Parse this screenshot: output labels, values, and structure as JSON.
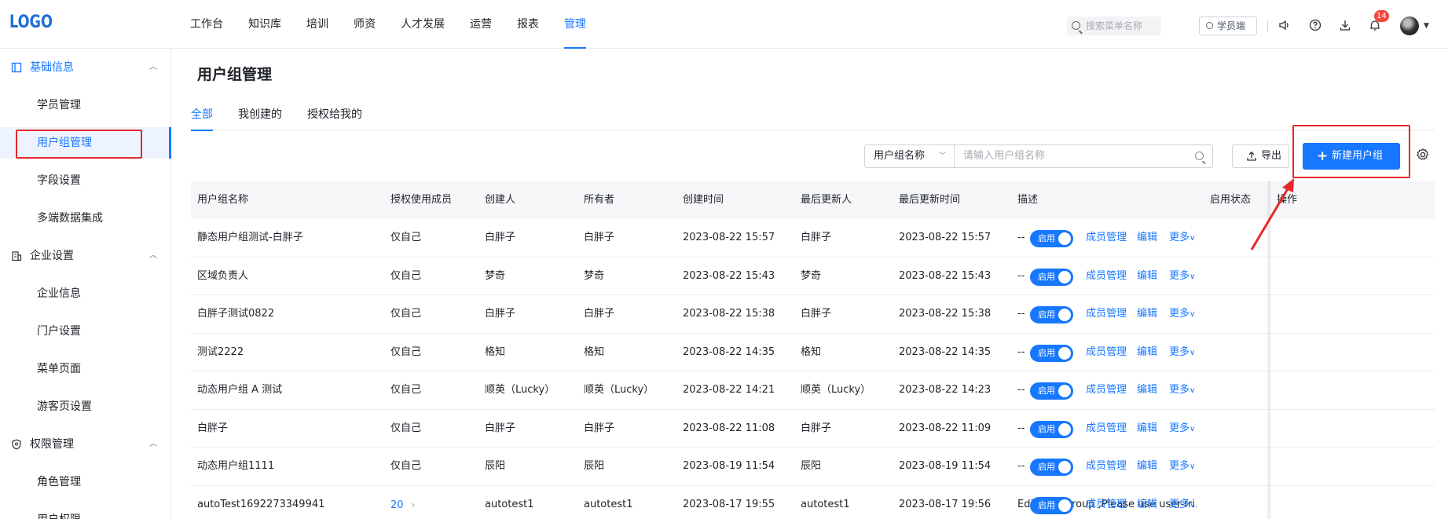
{
  "logo": "LOGO",
  "nav": [
    "工作台",
    "知识库",
    "培训",
    "师资",
    "人才发展",
    "运营",
    "报表",
    "管理"
  ],
  "nav_active": "管理",
  "top_search_placeholder": "搜索菜单名称",
  "student_button": "学员端",
  "notification_count": "14",
  "sidebar": {
    "group1": "基础信息",
    "group1_items": [
      "学员管理",
      "用户组管理",
      "字段设置",
      "多端数据集成"
    ],
    "group2": "企业设置",
    "group2_items": [
      "企业信息",
      "门户设置",
      "菜单页面",
      "游客页设置"
    ],
    "group3": "权限管理",
    "group3_items": [
      "角色管理",
      "用户权限"
    ]
  },
  "page_title": "用户组管理",
  "tabs": [
    "全部",
    "我创建的",
    "授权给我的"
  ],
  "filter": {
    "select_value": "用户组名称",
    "placeholder": "请输入用户组名称"
  },
  "export_label": "导出",
  "new_label": "新建用户组",
  "columns": [
    "用户组名称",
    "授权使用成员",
    "创建人",
    "所有者",
    "创建时间",
    "最后更新人",
    "最后更新时间",
    "描述",
    "启用状态",
    "操作"
  ],
  "rows": [
    {
      "name": "静态用户组测试-白胖子",
      "auth": "仅自己",
      "creator": "白胖子",
      "owner": "白胖子",
      "created": "2023-08-22 15:57",
      "updater": "白胖子",
      "updated": "2023-08-22 15:57",
      "desc": "--",
      "status": "启用"
    },
    {
      "name": "区域负责人",
      "auth": "仅自己",
      "creator": "梦奇",
      "owner": "梦奇",
      "created": "2023-08-22 15:43",
      "updater": "梦奇",
      "updated": "2023-08-22 15:43",
      "desc": "--",
      "status": "启用"
    },
    {
      "name": "白胖子测试0822",
      "auth": "仅自己",
      "creator": "白胖子",
      "owner": "白胖子",
      "created": "2023-08-22 15:38",
      "updater": "白胖子",
      "updated": "2023-08-22 15:38",
      "desc": "--",
      "status": "启用"
    },
    {
      "name": "测试2222",
      "auth": "仅自己",
      "creator": "格知",
      "owner": "格知",
      "created": "2023-08-22 14:35",
      "updater": "格知",
      "updated": "2023-08-22 14:35",
      "desc": "--",
      "status": "启用"
    },
    {
      "name": "动态用户组 A 测试",
      "auth": "仅自己",
      "creator": "顺英（Lucky）",
      "owner": "顺英（Lucky）",
      "created": "2023-08-22 14:21",
      "updater": "顺英（Lucky）",
      "updated": "2023-08-22 14:23",
      "desc": "--",
      "status": "启用"
    },
    {
      "name": "白胖子",
      "auth": "仅自己",
      "creator": "白胖子",
      "owner": "白胖子",
      "created": "2023-08-22 11:08",
      "updater": "白胖子",
      "updated": "2023-08-22 11:09",
      "desc": "--",
      "status": "启用"
    },
    {
      "name": "动态用户组1111",
      "auth": "仅自己",
      "creator": "辰阳",
      "owner": "辰阳",
      "created": "2023-08-19 11:54",
      "updater": "辰阳",
      "updated": "2023-08-19 11:54",
      "desc": "--",
      "status": "启用"
    },
    {
      "name": "autoTest1692273349941",
      "auth": "20",
      "creator": "autotest1",
      "owner": "autotest1",
      "created": "2023-08-17 19:55",
      "updater": "autotest1",
      "updated": "2023-08-17 19:56",
      "desc": "Edit UserGroup ,Please use user-fri...",
      "status": "启用"
    }
  ],
  "actions": [
    "成员管理",
    "编辑",
    "更多"
  ],
  "colors": {
    "accent": "#1677ff",
    "highlight": "#e8262b",
    "badge": "#f5463b"
  }
}
